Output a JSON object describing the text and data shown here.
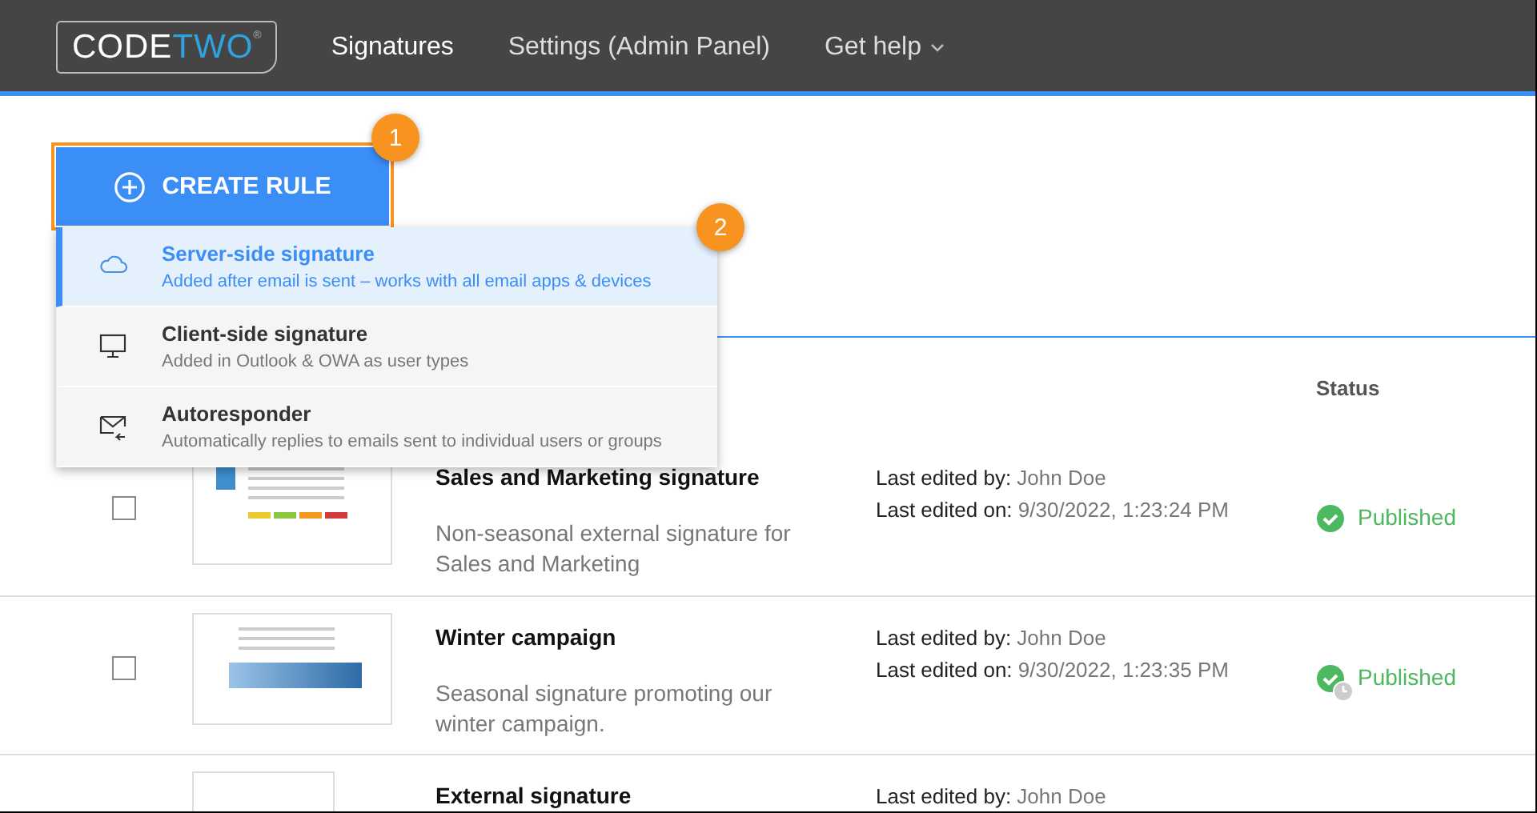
{
  "header": {
    "logo": {
      "part_1": "CODE",
      "part_2": "TWO",
      "mark": "®"
    },
    "tabs": [
      {
        "label": "Signatures",
        "selected": true,
        "has_menu": false
      },
      {
        "label": "Settings (Admin Panel)",
        "selected": false,
        "has_menu": false
      },
      {
        "label": "Get help",
        "selected": false,
        "has_menu": true
      }
    ]
  },
  "create_button": {
    "label": "CREATE RULE",
    "callout": "1"
  },
  "create_menu": {
    "callout": "2",
    "items": [
      {
        "kind": "cloud",
        "title": "Server-side signature",
        "subtitle": "Added after email is sent – works with all email apps & devices",
        "selected": true
      },
      {
        "kind": "monitor",
        "title": "Client-side signature",
        "subtitle": "Added in Outlook & OWA as user types",
        "selected": false
      },
      {
        "kind": "mail",
        "title": "Autoresponder",
        "subtitle": "Automatically replies to emails sent to individual users or groups",
        "selected": false
      }
    ]
  },
  "table": {
    "status_header": "Status",
    "rows": [
      {
        "checked": false,
        "kind": "company",
        "title": "Sales and Marketing signature",
        "description": "Non-seasonal external signature for Sales and Marketing",
        "edited": [
          {
            "label": "Last edited by:",
            "value": "John Doe"
          },
          {
            "label": "Last edited on:",
            "value": "9/30/2022, 1:23:24 PM"
          }
        ],
        "status": "Published",
        "scheduled": false
      },
      {
        "checked": false,
        "kind": "banner",
        "title": "Winter campaign",
        "description": "Seasonal signature promoting our winter campaign.",
        "edited": [
          {
            "label": "Last edited by:",
            "value": "John Doe"
          },
          {
            "label": "Last edited on:",
            "value": "9/30/2022, 1:23:35 PM"
          }
        ],
        "status": "Published",
        "scheduled": true
      },
      {
        "kind": "blank",
        "title": "External signature",
        "edited": [
          {
            "label": "Last edited by:",
            "value": "John Doe"
          }
        ]
      }
    ]
  }
}
